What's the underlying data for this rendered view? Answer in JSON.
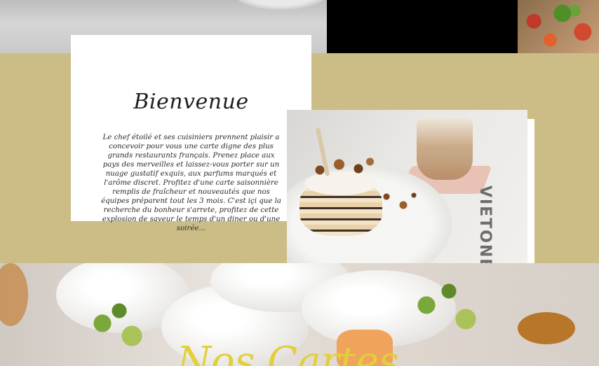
{
  "welcome": {
    "title": "Bienvenue",
    "text": "Le chef étoilé et ses cuisiniers prennent plaisir a concevoir pour vous une carte digne des plus grands restaurants français. Prenez place aux pays des merveilles et laissez-vous porter sur un nuage gustatif exquis, aux parfums marqués et l'arôme discret. Profitez d'une carte saisonnière remplis de fraîcheur et nouveautés que nos équipes préparent tout les 3 mois. C'est içi que la recherche du bonheur s'arrete, profitez de cette explosion de saveur le temps d'un diner ou d'une soirée..."
  },
  "dessert_photo": {
    "brand_mark": "VIETONE"
  },
  "bottom_heading": "Nos Cartes"
}
